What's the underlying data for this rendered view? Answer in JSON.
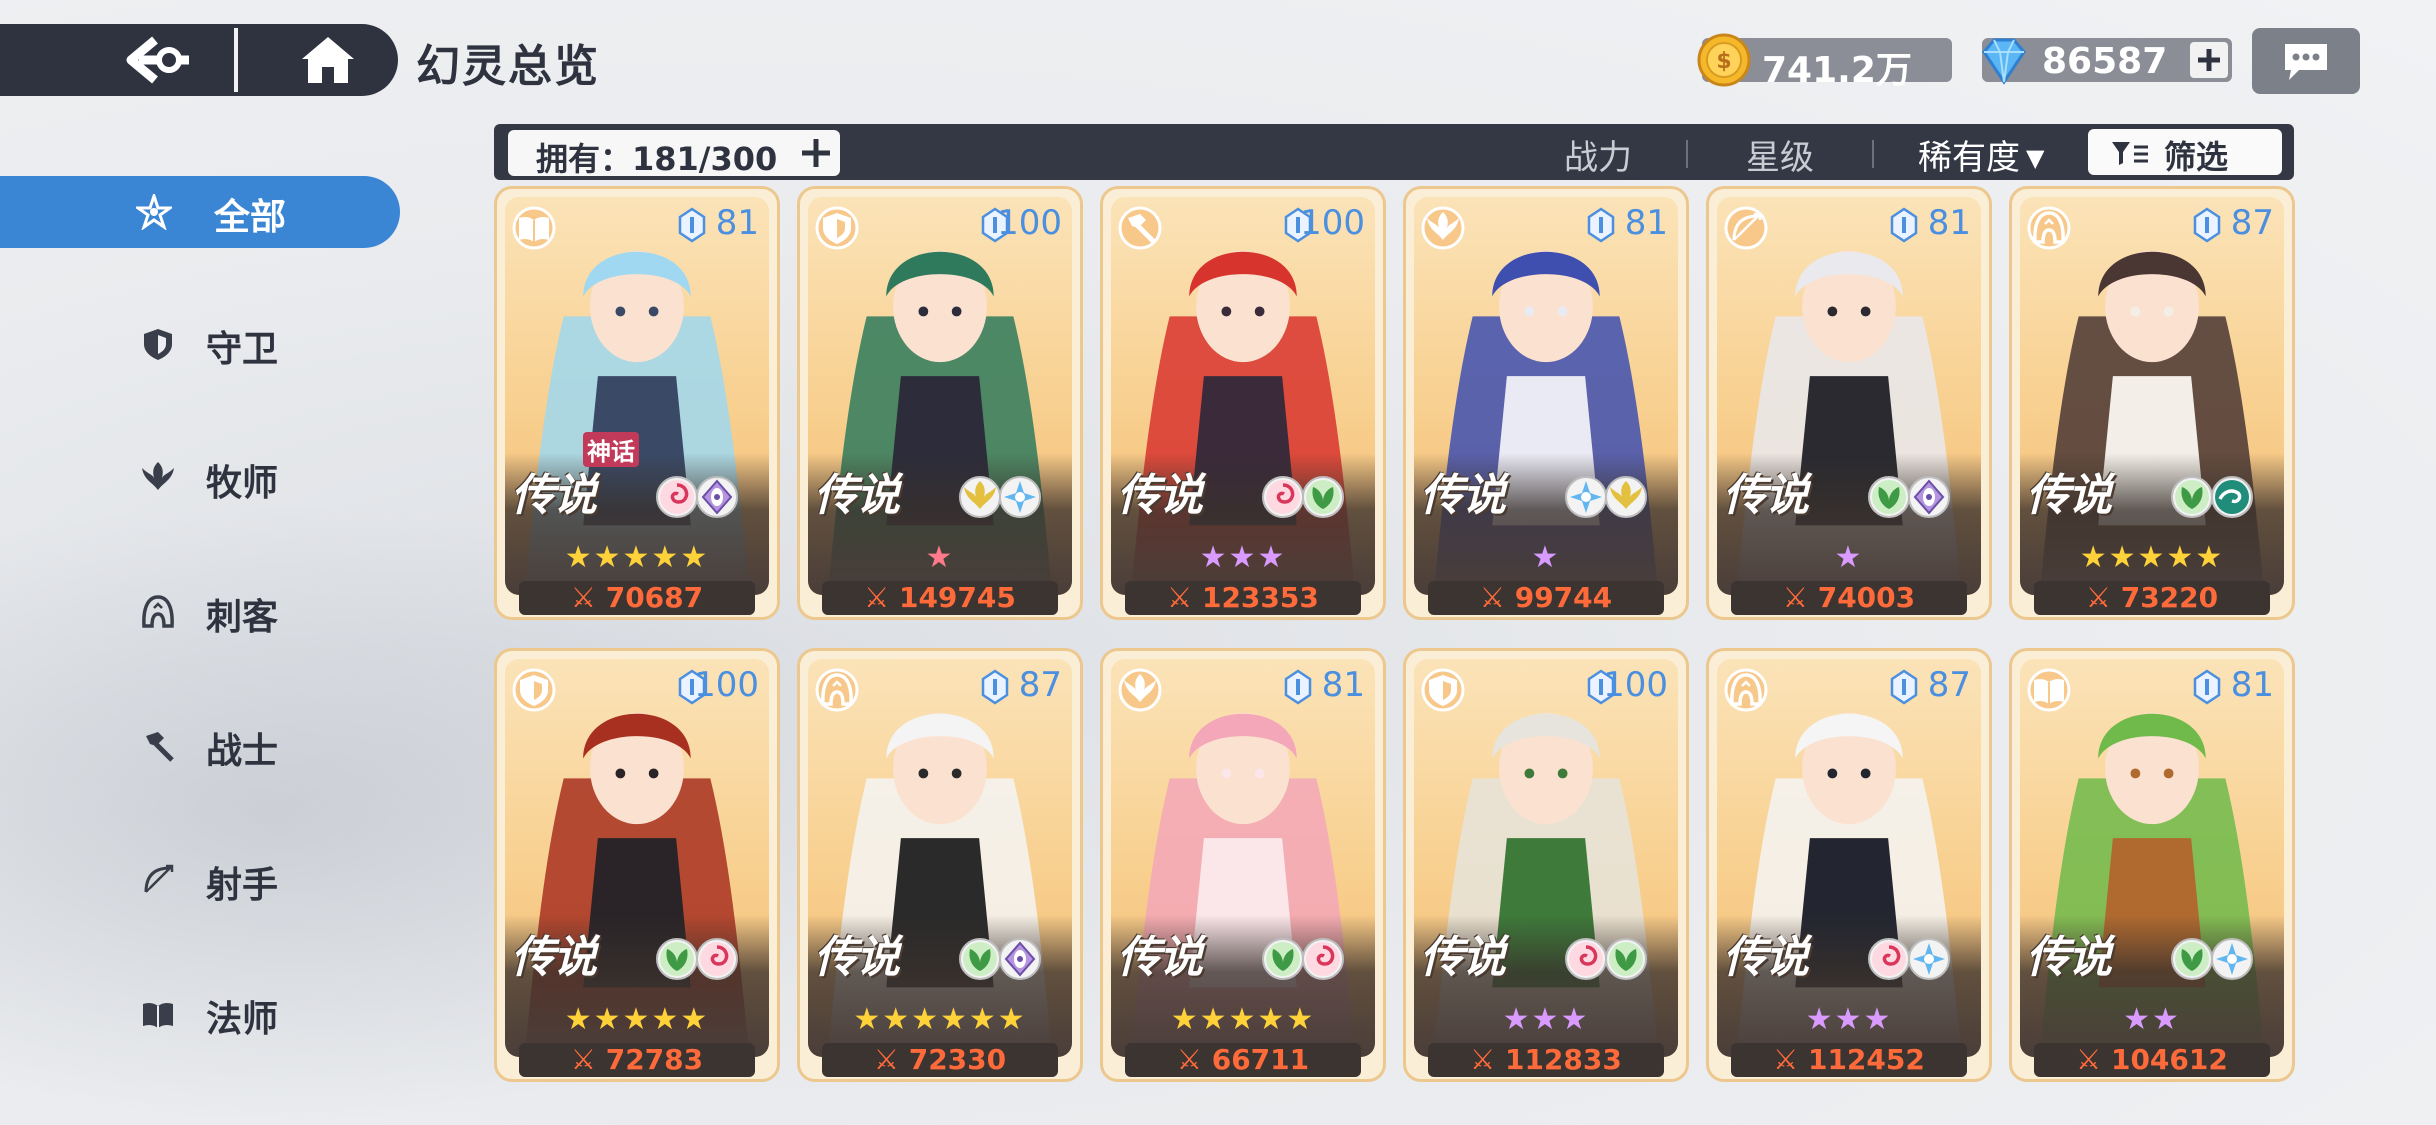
{
  "header": {
    "title": "幻灵总览"
  },
  "currency": {
    "gold": {
      "icon": "gold-coin-icon",
      "value": "741.2万"
    },
    "gem": {
      "icon": "blue-gem-icon",
      "value": "86587"
    }
  },
  "filterbar": {
    "owned_label": "拥有：181/300",
    "sort_power": "战力",
    "sort_star": "星级",
    "sort_rarity": "稀有度",
    "sort_rarity_arrow": "▼",
    "filter_label": "筛选"
  },
  "sidebar": {
    "items": [
      {
        "label": "全部",
        "icon": "star-all-icon",
        "active": true
      },
      {
        "label": "守卫",
        "icon": "shield-icon",
        "active": false
      },
      {
        "label": "牧师",
        "icon": "wings-icon",
        "active": false
      },
      {
        "label": "刺客",
        "icon": "hood-icon",
        "active": false
      },
      {
        "label": "战士",
        "icon": "hammer-icon",
        "active": false
      },
      {
        "label": "射手",
        "icon": "bow-icon",
        "active": false
      },
      {
        "label": "法师",
        "icon": "book-icon",
        "active": false
      }
    ]
  },
  "cards": [
    {
      "level": "81",
      "rarity": "传说",
      "myth": "神话",
      "class_icon": "book-icon",
      "elements": [
        "swirl-icon",
        "eye-icon"
      ],
      "stars": 5,
      "star_color": "#ffd23a",
      "power": "70687",
      "palette": [
        "#9fd8f0",
        "#3a4a66"
      ]
    },
    {
      "level": "100",
      "rarity": "传说",
      "myth": "",
      "class_icon": "shield-icon",
      "elements": [
        "wings-icon",
        "frost-icon"
      ],
      "stars": 1,
      "star_color": "#ff7a8a",
      "power": "149745",
      "palette": [
        "#2f7a5c",
        "#2c2c3a"
      ]
    },
    {
      "level": "100",
      "rarity": "传说",
      "myth": "",
      "class_icon": "hammer-icon",
      "elements": [
        "swirl-icon",
        "leaf-icon"
      ],
      "stars": 3,
      "star_color": "#d99bff",
      "power": "123353",
      "palette": [
        "#d8342e",
        "#3b2a3a"
      ]
    },
    {
      "level": "81",
      "rarity": "传说",
      "myth": "",
      "class_icon": "wings-icon",
      "elements": [
        "frost-icon",
        "wings-icon"
      ],
      "stars": 1,
      "star_color": "#d99bff",
      "power": "99744",
      "palette": [
        "#3e4fb0",
        "#eaeaf5"
      ]
    },
    {
      "level": "81",
      "rarity": "传说",
      "myth": "",
      "class_icon": "bow-icon",
      "elements": [
        "leaf-icon",
        "eye-icon"
      ],
      "stars": 1,
      "star_color": "#d99bff",
      "power": "74003",
      "palette": [
        "#e9e9ee",
        "#2a2a30"
      ]
    },
    {
      "level": "87",
      "rarity": "传说",
      "myth": "",
      "class_icon": "hood-icon",
      "elements": [
        "leaf-icon",
        "wave-icon"
      ],
      "stars": 5,
      "star_color": "#ffd23a",
      "power": "73220",
      "palette": [
        "#4a3632",
        "#f3efe8"
      ]
    },
    {
      "level": "100",
      "rarity": "传说",
      "myth": "",
      "class_icon": "shield-icon",
      "elements": [
        "leaf-icon",
        "swirl-icon"
      ],
      "stars": 5,
      "star_color": "#ffd23a",
      "power": "72783",
      "palette": [
        "#a83020",
        "#2a2428"
      ]
    },
    {
      "level": "87",
      "rarity": "传说",
      "myth": "",
      "class_icon": "hood-icon",
      "elements": [
        "leaf-icon",
        "eye-icon"
      ],
      "stars": 6,
      "star_color": "#ffd23a",
      "power": "72330",
      "palette": [
        "#f4f4f4",
        "#2a2a2a"
      ]
    },
    {
      "level": "81",
      "rarity": "传说",
      "myth": "",
      "class_icon": "wings-icon",
      "elements": [
        "leaf-icon",
        "swirl-icon"
      ],
      "stars": 5,
      "star_color": "#ffd23a",
      "power": "66711",
      "palette": [
        "#f3a7b8",
        "#fbe6ea"
      ]
    },
    {
      "level": "100",
      "rarity": "传说",
      "myth": "",
      "class_icon": "shield-icon",
      "elements": [
        "swirl-icon",
        "leaf-icon"
      ],
      "stars": 3,
      "star_color": "#d99bff",
      "power": "112833",
      "palette": [
        "#e6e4dc",
        "#3e7a3a"
      ]
    },
    {
      "level": "87",
      "rarity": "传说",
      "myth": "",
      "class_icon": "hood-icon",
      "elements": [
        "swirl-icon",
        "frost-icon"
      ],
      "stars": 3,
      "star_color": "#d99bff",
      "power": "112452",
      "palette": [
        "#f5f5f5",
        "#232630"
      ]
    },
    {
      "level": "81",
      "rarity": "传说",
      "myth": "",
      "class_icon": "book-icon",
      "elements": [
        "leaf-icon",
        "frost-icon"
      ],
      "stars": 2,
      "star_color": "#d99bff",
      "power": "104612",
      "palette": [
        "#6fba4a",
        "#b06a30"
      ]
    }
  ],
  "colors": {
    "accent": "#3b86d4",
    "dark_bar": "#343845",
    "power_text": "#ff6a3a",
    "level_text": "#4a8fe0"
  }
}
